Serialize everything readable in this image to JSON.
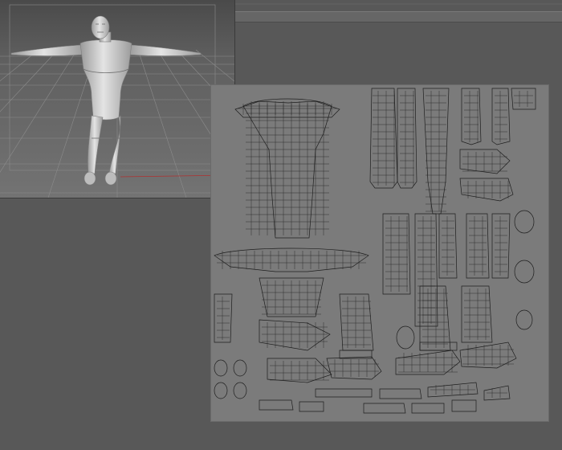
{
  "app": {
    "panels": {
      "viewport": {
        "icon": "3d-perspective-viewport",
        "model": "t-pose-humanoid"
      },
      "uv_editor": {
        "icon": "uv-layout-grid",
        "layout": "unwrapped-uv-islands"
      }
    }
  },
  "colors": {
    "background": "#585858",
    "viewport_floor": "#6e6e6e",
    "model_surface": "#cfcfcf",
    "uv_canvas": "#7b7b7b",
    "uv_lines": "#1e1e1e",
    "axis_red": "#b03030"
  }
}
